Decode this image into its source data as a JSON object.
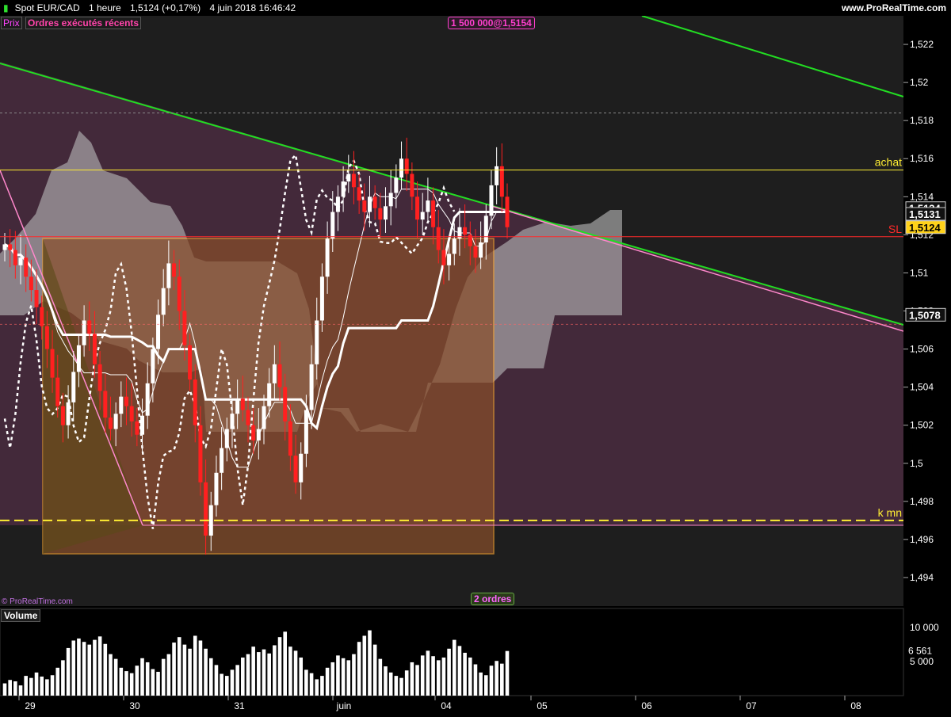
{
  "header": {
    "instrument": "Spot EUR/CAD",
    "period": "1 heure",
    "last": "1,5124 (+0,17%)",
    "datetime": "4 juin 2018 16:46:42",
    "site": "www.ProRealTime.com"
  },
  "legend": {
    "price_tag": "Prix",
    "orders_tag": "Ordres exécutés récents"
  },
  "orders": {
    "top_label": "1 500 000@1,5154",
    "bottom_label": "2 ordres"
  },
  "copyright": "© ProRealTime.com",
  "volume_panel": {
    "title": "Volume",
    "ticks": [
      "10 000",
      "5 000"
    ],
    "current_label": "6 561"
  },
  "colors": {
    "background": "#000000",
    "panel_bg": "#221c20",
    "cloud_light": "#d8d8d8",
    "cloud_pink": "#5a3a4e",
    "box_orange": "#f0a030",
    "trend_green": "#22dd22",
    "trend_pink": "#ff88cc",
    "level_yellow": "#ffee33",
    "sl_red": "#ff2a2a",
    "candle_up": "#ffffff",
    "candle_down": "#ff2020"
  },
  "chart_data": [
    {
      "type": "candlestick",
      "title": "Spot EUR/CAD 1 heure",
      "x": [
        "29",
        "30",
        "31",
        "juin",
        "04",
        "05",
        "06",
        "07",
        "08"
      ],
      "y_ticks": [
        "1,522",
        "1,52",
        "1,518",
        "1,516",
        "1,514",
        "1,512",
        "1,51",
        "1,508",
        "1,506",
        "1,504",
        "1,502",
        "1,5",
        "1,498",
        "1,496",
        "1,494"
      ],
      "ylim": [
        1.4925,
        1.5235
      ],
      "last_price": 1.5124,
      "price_labels": [
        {
          "text": "1,5134",
          "value": 1.5134
        },
        {
          "text": "1,5131",
          "value": 1.5131
        },
        {
          "text": "1,5124",
          "value": 1.5124
        },
        {
          "text": "1,5078",
          "value": 1.5078
        }
      ],
      "levels": [
        {
          "name": "achat",
          "value": 1.5154
        },
        {
          "name": "SL",
          "value": 1.5119
        },
        {
          "name": "k mn",
          "value": 1.497
        }
      ],
      "closes": [
        1.5115,
        1.5112,
        1.5104,
        1.5108,
        1.5098,
        1.5091,
        1.5082,
        1.5072,
        1.506,
        1.5045,
        1.503,
        1.502,
        1.5032,
        1.5048,
        1.5062,
        1.5075,
        1.5068,
        1.5052,
        1.5038,
        1.5024,
        1.5018,
        1.5026,
        1.5035,
        1.503,
        1.5022,
        1.5015,
        1.5025,
        1.5042,
        1.506,
        1.5078,
        1.5092,
        1.5105,
        1.5098,
        1.508,
        1.5062,
        1.5044,
        1.502,
        1.499,
        1.4962,
        1.4978,
        1.4995,
        1.5008,
        1.5018,
        1.5026,
        1.5034,
        1.5028,
        1.502,
        1.5012,
        1.5018,
        1.503,
        1.5042,
        1.5052,
        1.504,
        1.5022,
        1.5004,
        1.499,
        1.5005,
        1.5028,
        1.5052,
        1.5075,
        1.5098,
        1.5118,
        1.5132,
        1.514,
        1.5148,
        1.5152,
        1.5145,
        1.5138,
        1.5132,
        1.514,
        1.5134,
        1.5128,
        1.5135,
        1.5142,
        1.515,
        1.516,
        1.5152,
        1.514,
        1.5128,
        1.5132,
        1.5138,
        1.5124,
        1.5112,
        1.5104,
        1.511,
        1.5118,
        1.5124,
        1.512,
        1.5114,
        1.5108,
        1.5116,
        1.513,
        1.5146,
        1.5156,
        1.514,
        1.5124
      ],
      "volume": [
        1800,
        2300,
        2100,
        1500,
        2900,
        2600,
        3400,
        2800,
        2400,
        3000,
        4100,
        5200,
        7000,
        8100,
        8400,
        7900,
        7500,
        8200,
        8700,
        7600,
        6100,
        5400,
        4100,
        3600,
        3300,
        4400,
        5500,
        4900,
        3900,
        3500,
        5400,
        6100,
        7800,
        8600,
        7500,
        6900,
        8800,
        8100,
        6900,
        5500,
        4500,
        3200,
        2900,
        3800,
        4500,
        5600,
        6100,
        7200,
        6400,
        6800,
        6200,
        7400,
        8600,
        9400,
        7200,
        6600,
        5600,
        3800,
        3300,
        2400,
        2900,
        4100,
        4900,
        5900,
        5500,
        5200,
        6100,
        7900,
        8800,
        9600,
        7500,
        5400,
        4300,
        3400,
        2900,
        2600,
        3700,
        4900,
        4500,
        5900,
        6600,
        5800,
        5200,
        5600,
        6900,
        8200,
        7300,
        6300,
        5600,
        4600,
        3400,
        3000,
        4400,
        5100,
        4700,
        6561
      ]
    }
  ]
}
